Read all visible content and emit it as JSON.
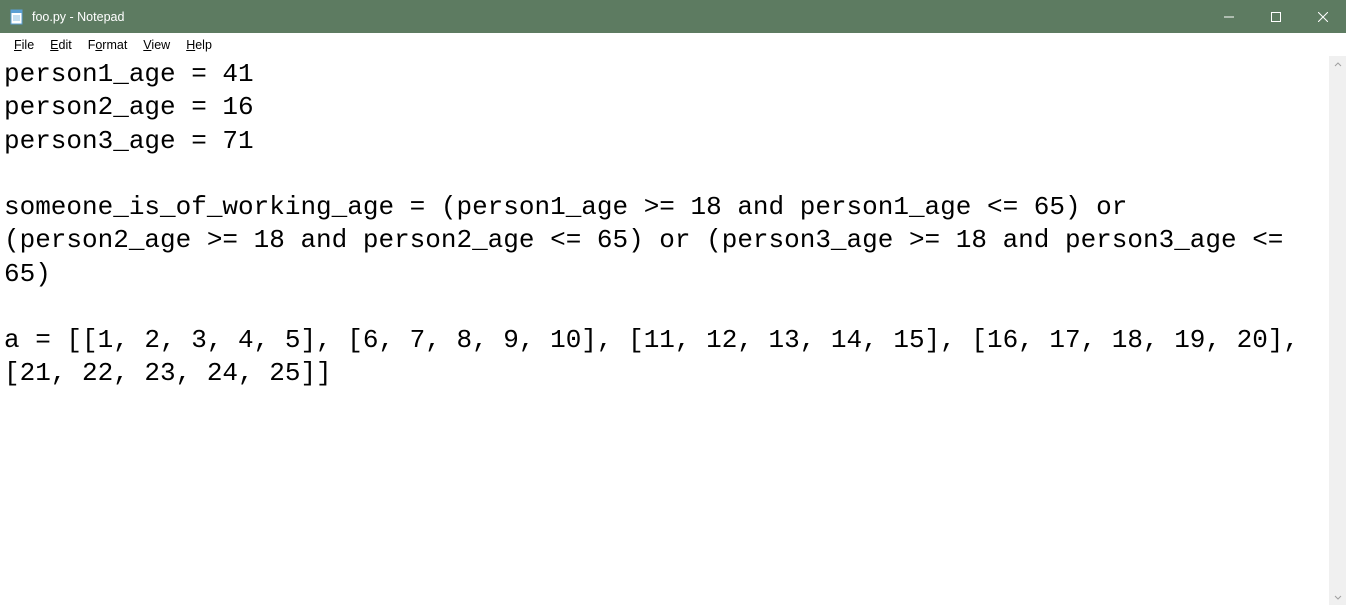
{
  "titlebar": {
    "title": "foo.py - Notepad"
  },
  "menubar": {
    "file": "File",
    "edit": "Edit",
    "format": "Format",
    "view": "View",
    "help": "Help"
  },
  "editor": {
    "content": "person1_age = 41\nperson2_age = 16\nperson3_age = 71\n\nsomeone_is_of_working_age = (person1_age >= 18 and person1_age <= 65) or (person2_age >= 18 and person2_age <= 65) or (person3_age >= 18 and person3_age <= 65)\n\na = [[1, 2, 3, 4, 5], [6, 7, 8, 9, 10], [11, 12, 13, 14, 15], [16, 17, 18, 19, 20], [21, 22, 23, 24, 25]]\n"
  }
}
